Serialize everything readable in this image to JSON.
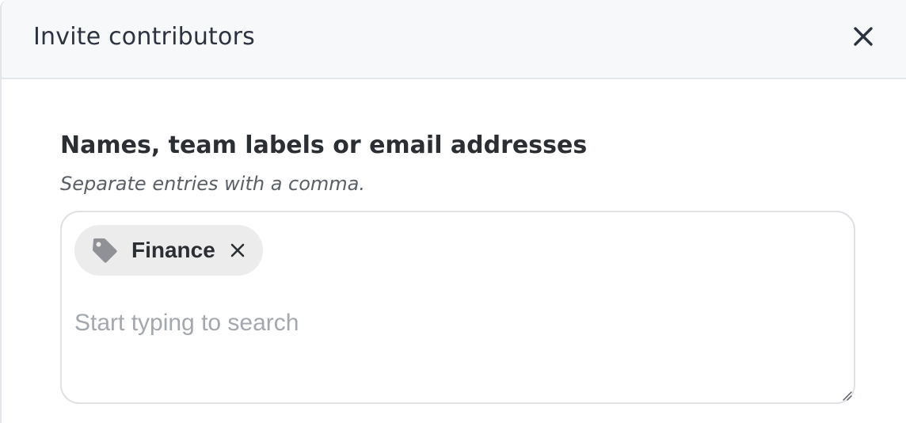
{
  "dialog": {
    "title": "Invite contributors",
    "close_icon": "close-icon"
  },
  "field": {
    "label": "Names, team labels or email addresses",
    "hint": "Separate entries with a comma.",
    "chips": [
      {
        "label": "Finance",
        "icon": "tag-icon",
        "remove_icon": "remove-icon"
      }
    ],
    "input": {
      "value": "",
      "placeholder": "Start typing to search"
    }
  },
  "colors": {
    "header_bg": "#f7f8fa",
    "chip_bg": "#ececec",
    "text": "#2b2e33",
    "placeholder": "#a3a7ae"
  }
}
